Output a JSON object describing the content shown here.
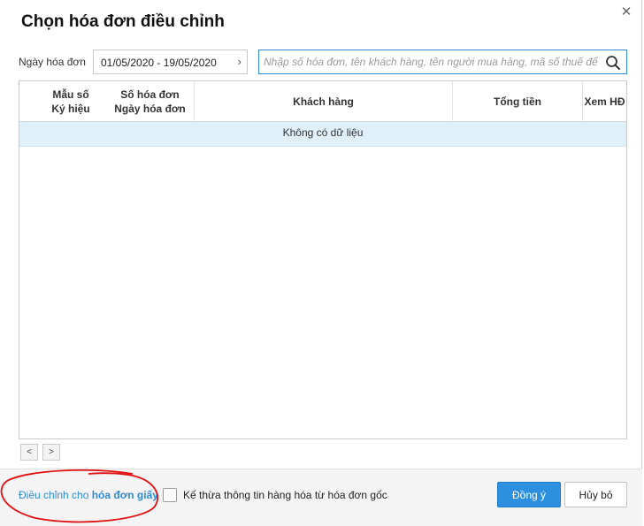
{
  "dialog": {
    "title": "Chọn hóa đơn điều chỉnh",
    "close_icon": "close-icon"
  },
  "filter": {
    "date_label": "Ngày hóa đơn",
    "date_range": "01/05/2020 - 19/05/2020",
    "date_chevron": "›",
    "search_placeholder": "Nhập số hóa đơn, tên khách hàng, tên người mua hàng, mã số thuế để tìm",
    "search_icon": "search-icon"
  },
  "grid": {
    "columns": [
      {
        "line1": "Mẫu số",
        "line2": "Ký hiệu"
      },
      {
        "line1": "Số hóa đơn",
        "line2": "Ngày hóa đơn"
      },
      {
        "line1": "Khách hàng"
      },
      {
        "line1": "Tổng tiền"
      },
      {
        "line1": "Xem HĐ"
      }
    ],
    "empty_text": "Không có dữ liệu"
  },
  "pager": {
    "prev": "<",
    "next": ">"
  },
  "footer": {
    "link_prefix": "Điều chỉnh cho ",
    "link_bold": "hóa đơn giấy",
    "inherit_label": "Kế thừa thông tin hàng hóa từ hóa đơn gốc",
    "ok_label": "Đồng ý",
    "cancel_label": "Hủy bỏ"
  },
  "colors": {
    "accent": "#2d8fe0",
    "empty_row_bg": "#dff0f8",
    "annotation": "#e01010"
  }
}
